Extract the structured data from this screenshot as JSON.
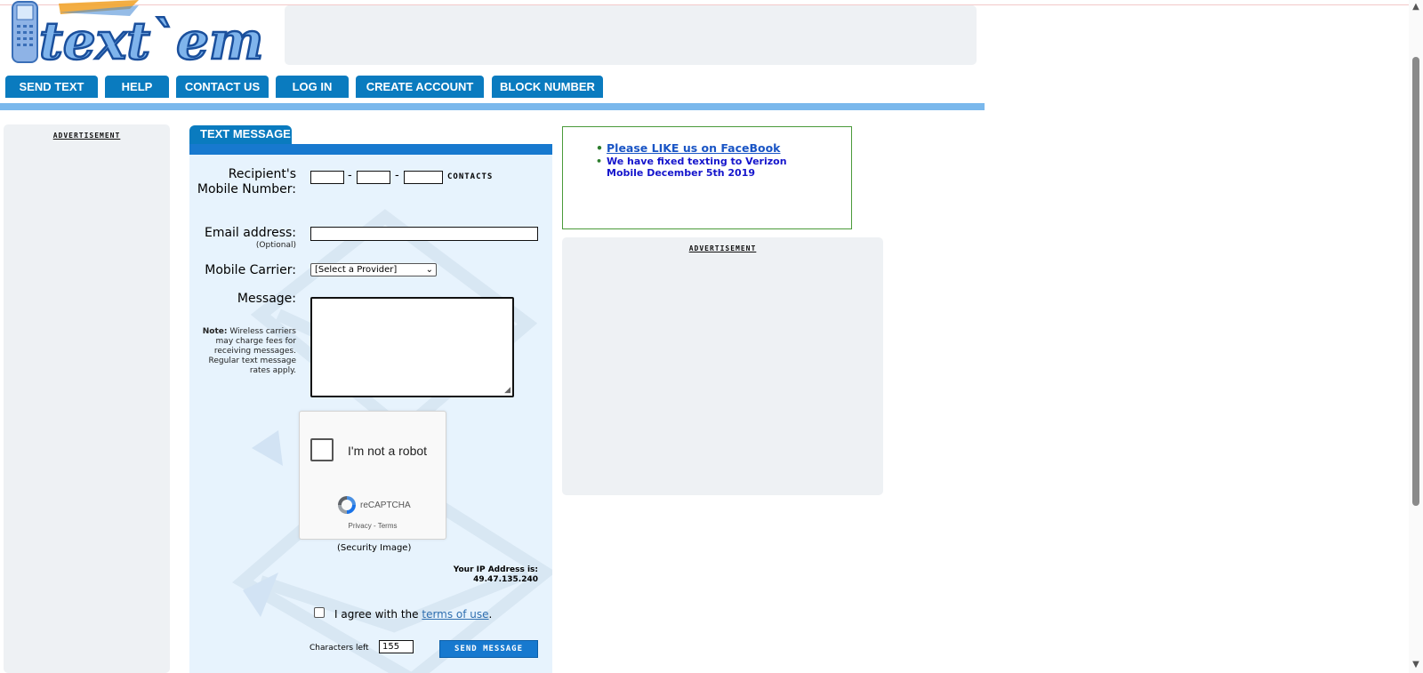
{
  "site": {
    "logo_text": "text`em"
  },
  "nav": {
    "items": [
      {
        "label": "SEND TEXT"
      },
      {
        "label": "HELP"
      },
      {
        "label": "CONTACT US"
      },
      {
        "label": "LOG IN"
      },
      {
        "label": "CREATE ACCOUNT"
      },
      {
        "label": "BLOCK NUMBER"
      }
    ]
  },
  "left_ad": {
    "label": "ADVERTISEMENT"
  },
  "form": {
    "tab_label": "TEXT MESSAGE",
    "recipient_label": "Recipient's Mobile Number:",
    "phone_part1": "",
    "phone_part2": "",
    "phone_part3": "",
    "phone_dash": "-",
    "contacts_label": "CONTACTS",
    "email_label": "Email address:",
    "email_optional": "(Optional)",
    "email_value": "",
    "carrier_label": "Mobile Carrier:",
    "carrier_selected": "[Select a Provider]",
    "message_label": "Message:",
    "note_bold": "Note:",
    "note_text": " Wireless carriers may charge fees for receiving messages. Regular text message rates apply.",
    "captcha": {
      "checkbox_label": "I'm not a robot",
      "brand": "reCAPTCHA",
      "privacy": "Privacy",
      "separator": " - ",
      "terms": "Terms"
    },
    "security_image_label": "(Security Image)",
    "ip_label": "Your IP Address is:",
    "ip_value": "49.47.135.240",
    "agree_prefix": "I agree with the ",
    "agree_link": "terms of use",
    "agree_suffix": ".",
    "chars_left_label": "Characters left",
    "chars_left_value": "155",
    "send_button": "SEND MESSAGE"
  },
  "news": {
    "items": [
      {
        "text": "Please LIKE us on FaceBook",
        "is_link": true
      },
      {
        "text": "We have fixed texting to Verizon Mobile December 5th 2019",
        "is_link": false
      }
    ]
  },
  "right_ad": {
    "label": "ADVERTISEMENT"
  },
  "colors": {
    "nav_blue": "#0a7bbf",
    "panel_blue": "#1779cf",
    "panel_bg": "#e7f3fd",
    "ad_bg": "#eef1f4",
    "news_border": "#4a9a3a",
    "news_text": "#1515cc"
  }
}
